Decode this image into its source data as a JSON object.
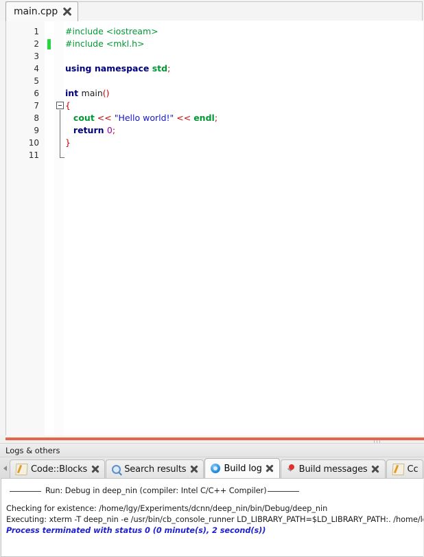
{
  "editor": {
    "tab": {
      "label": "main.cpp",
      "close_icon": "close-icon"
    },
    "lines": [
      {
        "n": "1",
        "tokens": [
          {
            "t": "#include <iostream>",
            "c": "t-pre"
          }
        ]
      },
      {
        "n": "2",
        "tokens": [
          {
            "t": "#include <mkl.h>",
            "c": "t-pre"
          }
        ],
        "modified": true
      },
      {
        "n": "3",
        "tokens": []
      },
      {
        "n": "4",
        "tokens": [
          {
            "t": "using namespace ",
            "c": "t-kw"
          },
          {
            "t": "std",
            "c": "t-std"
          },
          {
            "t": ";",
            "c": "t-op"
          }
        ]
      },
      {
        "n": "5",
        "tokens": []
      },
      {
        "n": "6",
        "tokens": [
          {
            "t": "int ",
            "c": "t-type"
          },
          {
            "t": "main",
            "c": "t-id"
          },
          {
            "t": "()",
            "c": "t-op"
          }
        ]
      },
      {
        "n": "7",
        "tokens": [
          {
            "t": "{",
            "c": "t-brace"
          }
        ],
        "fold": "open"
      },
      {
        "n": "8",
        "tokens": [
          {
            "t": "   ",
            "c": "t-id"
          },
          {
            "t": "cout",
            "c": "t-std"
          },
          {
            "t": " << ",
            "c": "t-op"
          },
          {
            "t": "\"Hello world!\"",
            "c": "t-str"
          },
          {
            "t": " << ",
            "c": "t-op"
          },
          {
            "t": "endl",
            "c": "t-std"
          },
          {
            "t": ";",
            "c": "t-op"
          }
        ]
      },
      {
        "n": "9",
        "tokens": [
          {
            "t": "   ",
            "c": "t-id"
          },
          {
            "t": "return ",
            "c": "t-kw"
          },
          {
            "t": "0",
            "c": "t-num"
          },
          {
            "t": ";",
            "c": "t-op"
          }
        ]
      },
      {
        "n": "10",
        "tokens": [
          {
            "t": "}",
            "c": "t-brace"
          }
        ]
      },
      {
        "n": "11",
        "tokens": []
      }
    ]
  },
  "logs_panel": {
    "title": "Logs & others",
    "scroll_left_icon": "chevron-left-icon",
    "tabs": [
      {
        "label": "Code::Blocks",
        "icon": "pencil-icon",
        "active": false
      },
      {
        "label": "Search results",
        "icon": "magnifier-icon",
        "active": false
      },
      {
        "label": "Build log",
        "icon": "blue-orb-icon",
        "active": true
      },
      {
        "label": "Build messages",
        "icon": "pin-icon",
        "active": false
      },
      {
        "label": "Cc",
        "icon": "pencil-icon",
        "active": false
      }
    ],
    "build_log": {
      "run_header": "Run: Debug in deep_nin (compiler: Intel C/C++ Compiler)",
      "lines": [
        "Checking for existence: /home/lgy/Experiments/dcnn/deep_nin/bin/Debug/deep_nin",
        "Executing: xterm -T deep_nin -e /usr/bin/cb_console_runner LD_LIBRARY_PATH=$LD_LIBRARY_PATH:. /home/lgy/Experiments/dc"
      ],
      "status_line": "Process terminated with status 0 (0 minute(s), 2 second(s))"
    }
  },
  "colors": {
    "splitter_accent": "#e2664f",
    "modified_marker": "#22d83c",
    "success_text": "#2222cc"
  }
}
